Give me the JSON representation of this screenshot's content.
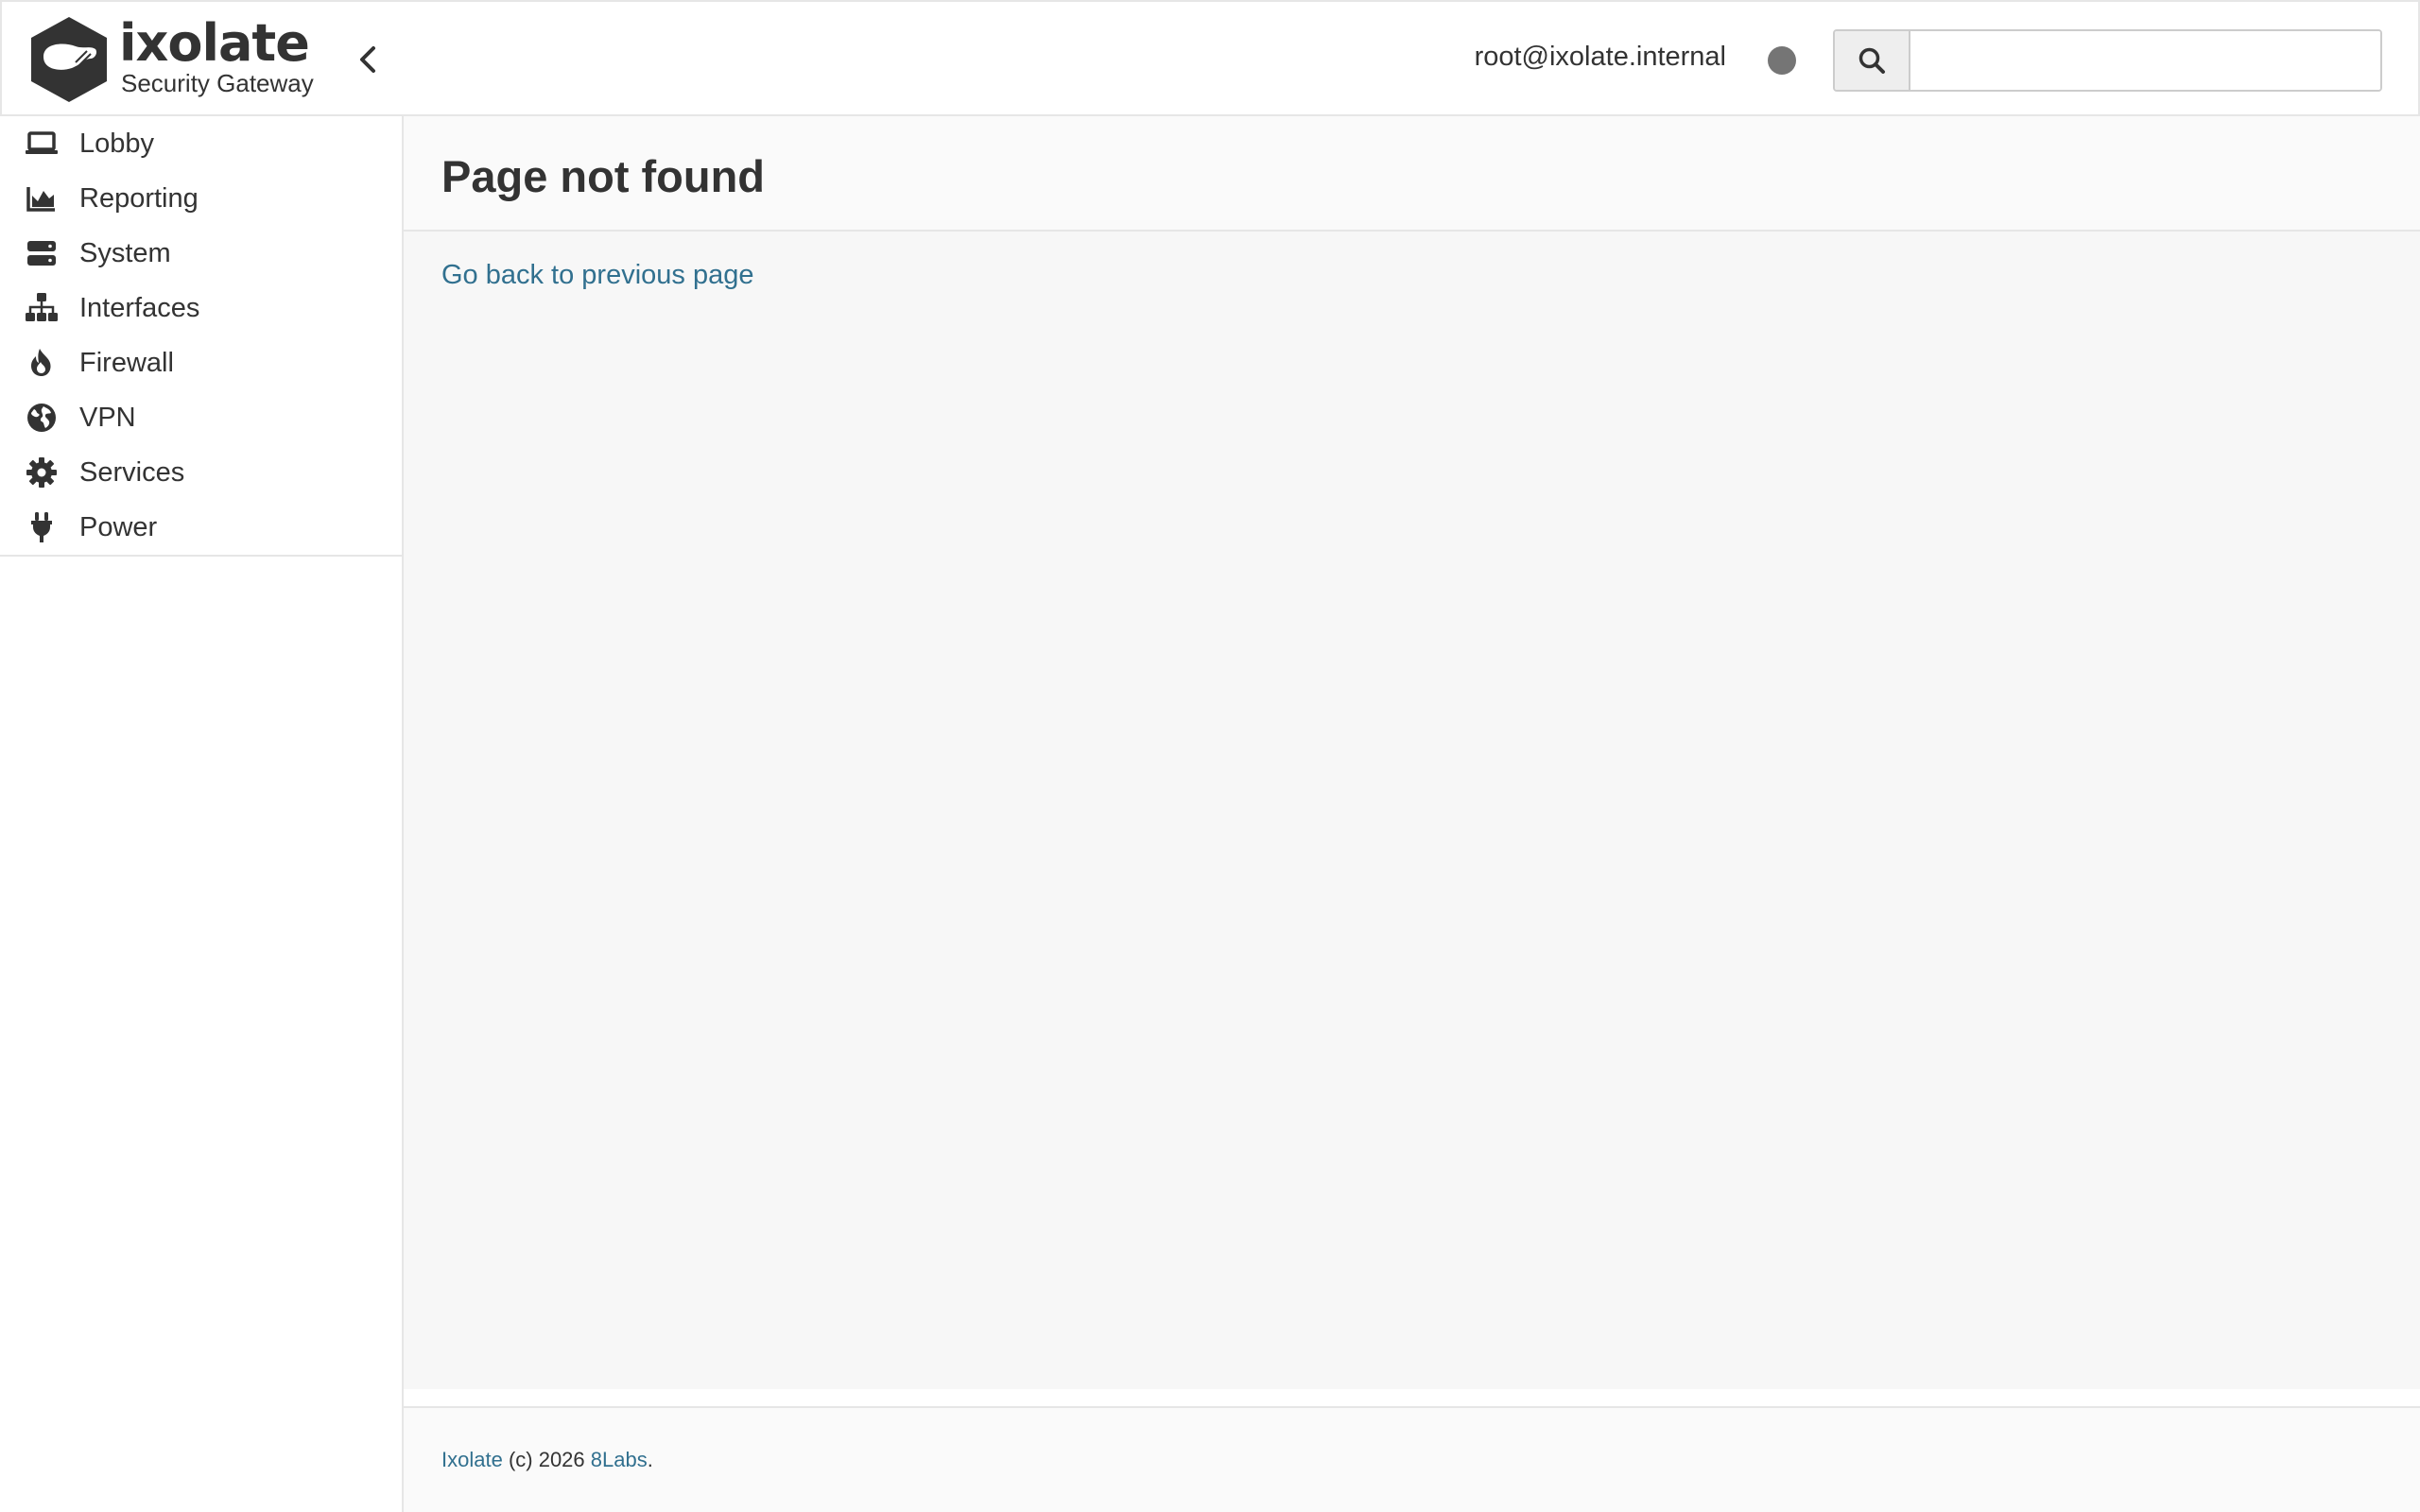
{
  "header": {
    "brand_name": "ixolate",
    "brand_tagline": "Security Gateway",
    "user": "root@ixolate.internal",
    "search": {
      "value": "",
      "placeholder": ""
    }
  },
  "sidebar": {
    "items": [
      {
        "label": "Lobby",
        "icon": "laptop-icon"
      },
      {
        "label": "Reporting",
        "icon": "area-chart-icon"
      },
      {
        "label": "System",
        "icon": "server-icon"
      },
      {
        "label": "Interfaces",
        "icon": "sitemap-icon"
      },
      {
        "label": "Firewall",
        "icon": "fire-icon"
      },
      {
        "label": "VPN",
        "icon": "globe-icon"
      },
      {
        "label": "Services",
        "icon": "cog-icon"
      },
      {
        "label": "Power",
        "icon": "plug-icon"
      }
    ]
  },
  "main": {
    "title": "Page not found",
    "back_link": "Go back to previous page"
  },
  "footer": {
    "product": "Ixolate",
    "copyright": " (c) 2026 ",
    "company": "8Labs",
    "suffix": "."
  },
  "colors": {
    "text": "#333333",
    "link": "#31708f",
    "status_dot": "#757575",
    "border": "#e6e6e6",
    "content_bg": "#f7f7f7"
  }
}
